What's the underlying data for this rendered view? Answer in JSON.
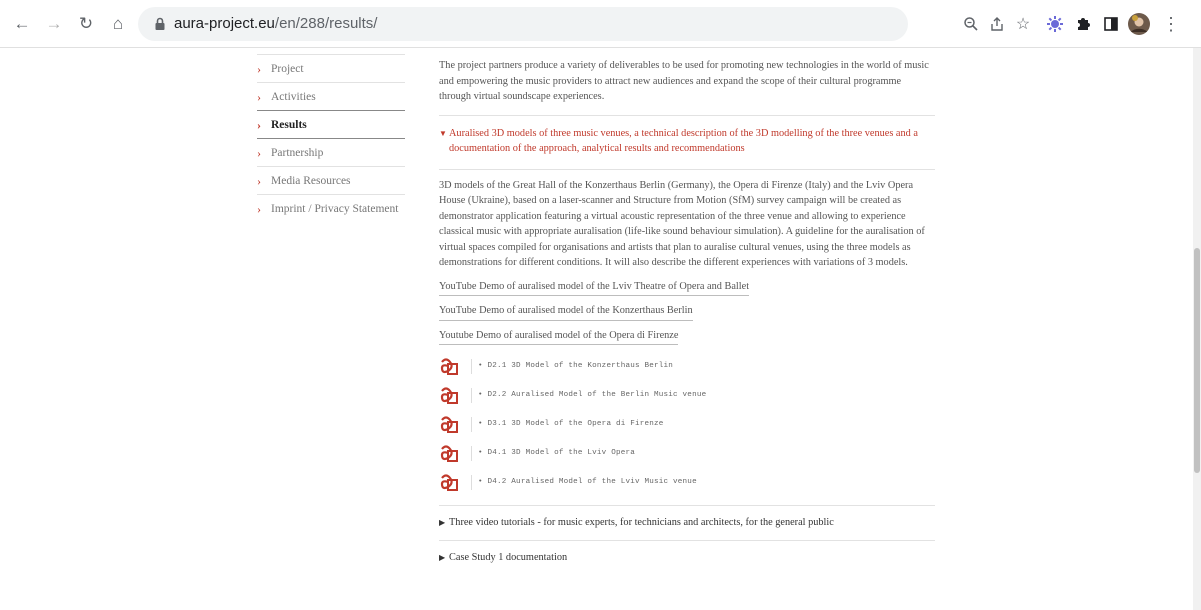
{
  "browser": {
    "url_domain": "aura-project.eu",
    "url_path": "/en/288/results/"
  },
  "sidebar": {
    "items": [
      {
        "label": "Project"
      },
      {
        "label": "Activities"
      },
      {
        "label": "Results"
      },
      {
        "label": "Partnership"
      },
      {
        "label": "Media Resources"
      },
      {
        "label": "Imprint / Privacy Statement"
      }
    ]
  },
  "main": {
    "intro": "The project partners produce a variety of deliverables to be used for promoting new technologies in the world of music and empowering the music providers to attract new audiences and expand the scope of their cultural programme through virtual soundscape experiences.",
    "open_section": {
      "title": "Auralised 3D models of three music venues, a technical description of the 3D modelling of the three venues and a documentation of the approach, analytical results and recommendations",
      "body": "3D models of the Great Hall of the Konzerthaus Berlin (Germany), the Opera di Firenze (Italy) and the Lviv Opera House (Ukraine), based on a laser-scanner and Structure from Motion (SfM) survey campaign will be created as demonstrator application featuring a virtual acoustic representation of the three venue and allowing to experience classical music with appropriate auralisation (life-like sound behaviour simulation). A guideline for the auralisation of virtual spaces compiled for organisations and artists that plan to auralise cultural venues, using the three models as demonstrations for different conditions. It will also describe the different experiences with variations of 3 models.",
      "links": [
        "YouTube Demo of auralised model of the Lviv Theatre of Opera and Ballet",
        "YouTube Demo of auralised model of the Konzerthaus Berlin",
        "Youtube Demo of auralised model of the Opera di Firenze"
      ],
      "documents": [
        "• D2.1 3D Model of the Konzerthaus Berlin",
        "• D2.2 Auralised Model of the Berlin Music venue",
        "• D3.1 3D Model of the Opera di Firenze",
        "• D4.1 3D Model of the Lviv Opera",
        "• D4.2 Auralised Model of the Lviv Music venue"
      ]
    },
    "closed_sections": [
      {
        "title": "Three video tutorials - for music experts, for technicians and architects, for the general public"
      },
      {
        "title": "Case Study 1 documentation"
      }
    ]
  },
  "colors": {
    "accent_red": "#c0392b",
    "text_gray": "#555555"
  },
  "icons": [
    "back-arrow-icon",
    "forward-arrow-icon",
    "reload-icon",
    "home-icon",
    "lock-icon",
    "zoom-icon",
    "share-icon",
    "star-icon",
    "extension-icon",
    "puzzle-icon",
    "sidepanel-icon",
    "profile-avatar",
    "menu-dots-icon",
    "pdf-icon"
  ]
}
